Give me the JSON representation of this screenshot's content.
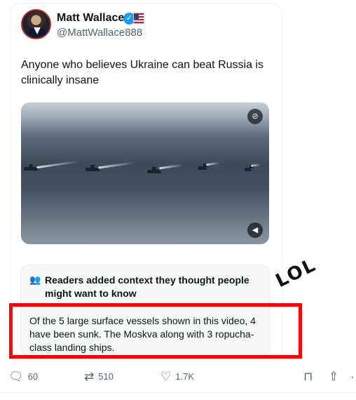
{
  "author": {
    "name": "Matt Wallace",
    "handle": "@MattWallace888",
    "verified": true,
    "avatar_icon": "profile-photo",
    "badge_icon": "us-flag-icon"
  },
  "tweet": {
    "text": "Anyone who believes Ukraine can beat Russia is clinically insane"
  },
  "media": {
    "type": "video",
    "top_icon": "media-badge-icon",
    "mute_icon": "mute-icon"
  },
  "community_note": {
    "icon": "people-icon",
    "heading": "Readers added context they thought people might want to know",
    "body": "Of the 5 large surface vessels shown in this video, 4 have been sunk. The Moskva along with 3 ropucha-class landing ships."
  },
  "annotation": {
    "handwritten": "LOL",
    "highlight_color": "#ff0000"
  },
  "actions": {
    "replies": "60",
    "retweets": "510",
    "likes": "1.7K"
  },
  "colors": {
    "accent": "#1d9bf0",
    "muted_text": "#536471"
  }
}
